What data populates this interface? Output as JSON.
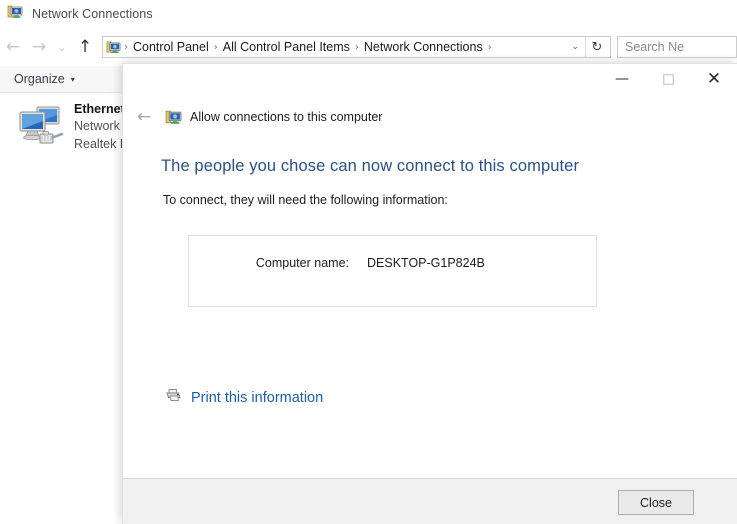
{
  "explorer": {
    "title": "Network Connections",
    "title_icon": "network-connections-icon",
    "nav": {
      "back": "←",
      "forward": "→",
      "recent": "⌄",
      "up": "↑"
    },
    "address": {
      "icon": "network-connections-icon",
      "crumbs": [
        "Control Panel",
        "All Control Panel Items",
        "Network Connections"
      ],
      "separator": "›",
      "trailing_separator": "›",
      "dropdown": "⌄",
      "refresh": "↻"
    },
    "search": {
      "placeholder": "Search Ne"
    },
    "toolbar": {
      "organize_label": "Organize",
      "caret": "▾"
    },
    "items": [
      {
        "name": "Ethernet",
        "network": "Network",
        "adapter": "Realtek PC",
        "icon": "ethernet-adapter-icon"
      }
    ]
  },
  "dialog": {
    "caption": {
      "minimize": "—",
      "maximize": "☐",
      "close": "✕"
    },
    "back_arrow": "←",
    "header_icon": "allow-connections-icon",
    "header_title": "Allow connections to this computer",
    "heading": "The people you chose can now connect to this computer",
    "subtext": "To connect, they will need the following information:",
    "info": {
      "label": "Computer name:",
      "value": "DESKTOP-G1P824B"
    },
    "print_link": {
      "icon": "printer-icon",
      "label": "Print this information"
    },
    "close_button": "Close"
  },
  "colors": {
    "heading_blue": "#2a5186",
    "link_blue": "#1f5fa9",
    "footer_bg": "#f0f0f0",
    "toolbar_bg": "#f7f7f7"
  }
}
